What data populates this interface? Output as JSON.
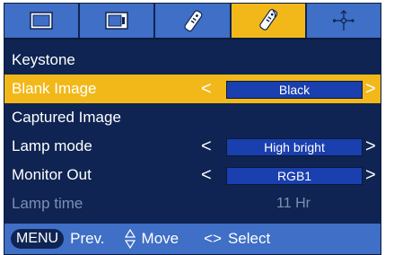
{
  "tabs": [
    {
      "icon": "picture-icon",
      "active": false
    },
    {
      "icon": "screen-icon",
      "active": false
    },
    {
      "icon": "remote-icon",
      "active": false
    },
    {
      "icon": "options-icon",
      "active": true
    },
    {
      "icon": "network-icon",
      "active": false
    }
  ],
  "menu": {
    "items": [
      {
        "label": "Keystone"
      },
      {
        "label": "Blank Image",
        "value": "Black"
      },
      {
        "label": "Captured Image"
      },
      {
        "label": "Lamp mode",
        "value": "High bright"
      },
      {
        "label": "Monitor Out",
        "value": "RGB1"
      },
      {
        "label": "Lamp time",
        "value": "11 Hr"
      }
    ],
    "arrow_left": "<",
    "arrow_right": ">"
  },
  "footer": {
    "menu_key": "MENU",
    "prev_label": "Prev.",
    "move_label": "Move",
    "select_symbol": "<>",
    "select_label": "Select"
  },
  "colors": {
    "background": "#0f2452",
    "tab": "#3f6fc6",
    "highlight": "#f2b81a",
    "value_box": "#1a3fae",
    "disabled_text": "#7f8fb3"
  }
}
